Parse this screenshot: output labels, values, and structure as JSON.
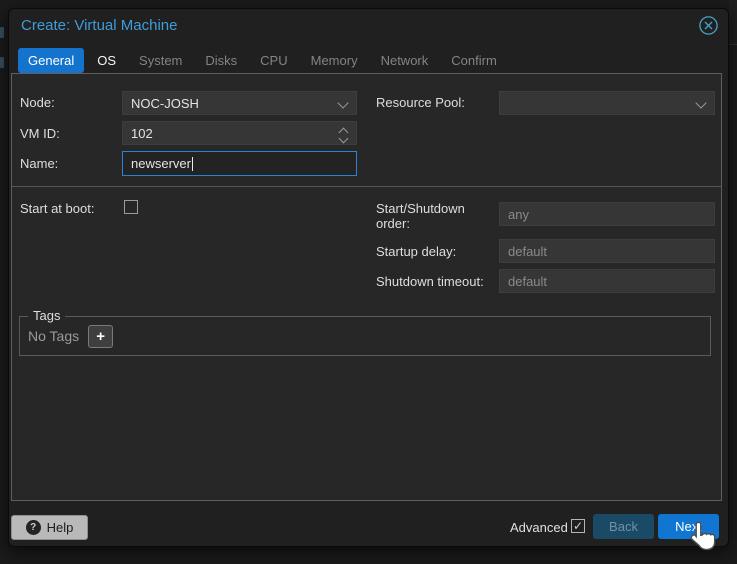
{
  "window": {
    "title": "Create: Virtual Machine"
  },
  "tabs": [
    {
      "label": "General",
      "state": "active"
    },
    {
      "label": "OS",
      "state": "available"
    },
    {
      "label": "System",
      "state": "disabled"
    },
    {
      "label": "Disks",
      "state": "disabled"
    },
    {
      "label": "CPU",
      "state": "disabled"
    },
    {
      "label": "Memory",
      "state": "disabled"
    },
    {
      "label": "Network",
      "state": "disabled"
    },
    {
      "label": "Confirm",
      "state": "disabled"
    }
  ],
  "form": {
    "node": {
      "label": "Node:",
      "value": "NOC-JOSH"
    },
    "resource_pool": {
      "label": "Resource Pool:",
      "value": ""
    },
    "vm_id": {
      "label": "VM ID:",
      "value": "102"
    },
    "name": {
      "label": "Name:",
      "value": "newserver"
    },
    "start_at_boot": {
      "label": "Start at boot:",
      "checked": false
    },
    "startup_order": {
      "label": "Start/Shutdown order:",
      "placeholder": "any"
    },
    "startup_delay": {
      "label": "Startup delay:",
      "placeholder": "default"
    },
    "shutdown_timeout": {
      "label": "Shutdown timeout:",
      "placeholder": "default"
    },
    "tags": {
      "legend": "Tags",
      "empty_text": "No Tags"
    }
  },
  "footer": {
    "help_label": "Help",
    "advanced_label": "Advanced",
    "advanced_checked": true,
    "back_label": "Back",
    "next_label": "Next"
  },
  "icons": {
    "close": "circled-x",
    "help_glyph": "?",
    "add_tag_glyph": "+",
    "check_glyph": "✓",
    "cursor": "hand-pointer"
  },
  "colors": {
    "title_blue": "#3f9cd9",
    "active_tab_blue": "#1474cd",
    "next_button_blue": "#1176d2",
    "focused_input_border": "#2e82d0",
    "panel_bg": "#272727",
    "dialog_bg": "#202020"
  }
}
